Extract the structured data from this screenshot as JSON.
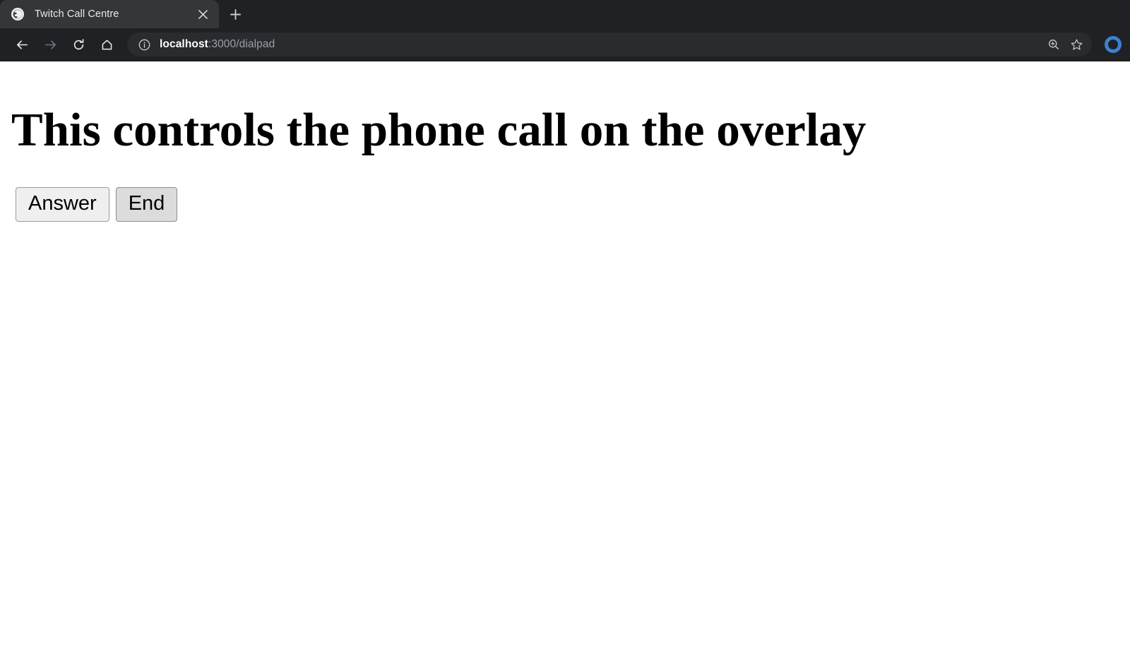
{
  "browser": {
    "tab": {
      "title": "Twitch Call Centre",
      "favicon_icon": "globe-icon",
      "close_icon": "close-icon"
    },
    "new_tab_icon": "plus-icon",
    "toolbar": {
      "back_icon": "arrow-left-icon",
      "forward_icon": "arrow-right-icon",
      "reload_icon": "reload-icon",
      "home_icon": "home-icon",
      "site_info_icon": "info-circle-icon",
      "url_host": "localhost",
      "url_path": ":3000/dialpad",
      "zoom_icon": "zoom-in-icon",
      "bookmark_icon": "star-icon",
      "profile_icon": "profile-avatar-icon"
    },
    "colors": {
      "chrome_bg": "#202124",
      "active_tab_bg": "#35363a",
      "omnibox_bg": "#2a2b2e",
      "text_primary": "#e8eaed",
      "text_secondary": "#9aa0a6",
      "profile_accent": "#3b82cf"
    }
  },
  "page": {
    "heading": "This controls the phone call on the overlay",
    "buttons": [
      {
        "label": "Answer",
        "state": "normal"
      },
      {
        "label": "End",
        "state": "pressed"
      }
    ]
  }
}
